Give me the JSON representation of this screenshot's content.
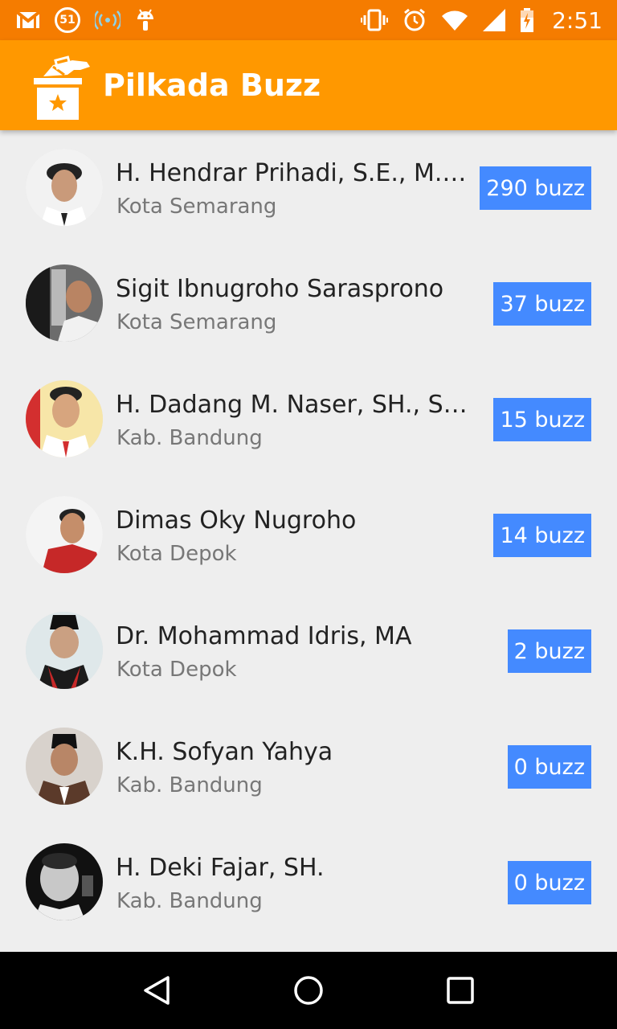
{
  "status_bar": {
    "notification_count": "51",
    "time": "2:51",
    "icons_left": [
      "gmail-icon",
      "notification-count-icon",
      "wifi-signal-icon",
      "android-icon"
    ],
    "icons_right": [
      "vibrate-icon",
      "alarm-icon",
      "wifi-icon",
      "cell-signal-icon",
      "battery-icon"
    ]
  },
  "app_bar": {
    "title": "Pilkada Buzz",
    "logo_icon": "ballot-box-icon",
    "color": "#ff9800"
  },
  "colors": {
    "status_bar": "#f57c00",
    "badge": "#448aff",
    "background": "#eeeeee"
  },
  "candidates": [
    {
      "name": "H. Hendrar Prihadi, S.E., M.M.",
      "region": "Kota Semarang",
      "buzz": "290 buzz"
    },
    {
      "name": "Sigit Ibnugroho Sarasprono",
      "region": "Kota Semarang",
      "buzz": "37 buzz"
    },
    {
      "name": "H. Dadang M. Naser, SH., S.IP...",
      "region": "Kab. Bandung",
      "buzz": "15 buzz"
    },
    {
      "name": "Dimas Oky Nugroho",
      "region": "Kota Depok",
      "buzz": "14 buzz"
    },
    {
      "name": "Dr. Mohammad Idris, MA",
      "region": "Kota Depok",
      "buzz": "2 buzz"
    },
    {
      "name": "K.H. Sofyan Yahya",
      "region": "Kab. Bandung",
      "buzz": "0 buzz"
    },
    {
      "name": "H. Deki Fajar, SH.",
      "region": "Kab. Bandung",
      "buzz": "0 buzz"
    }
  ],
  "nav_bar": {
    "buttons": [
      "back-icon",
      "home-icon",
      "recents-icon"
    ]
  }
}
